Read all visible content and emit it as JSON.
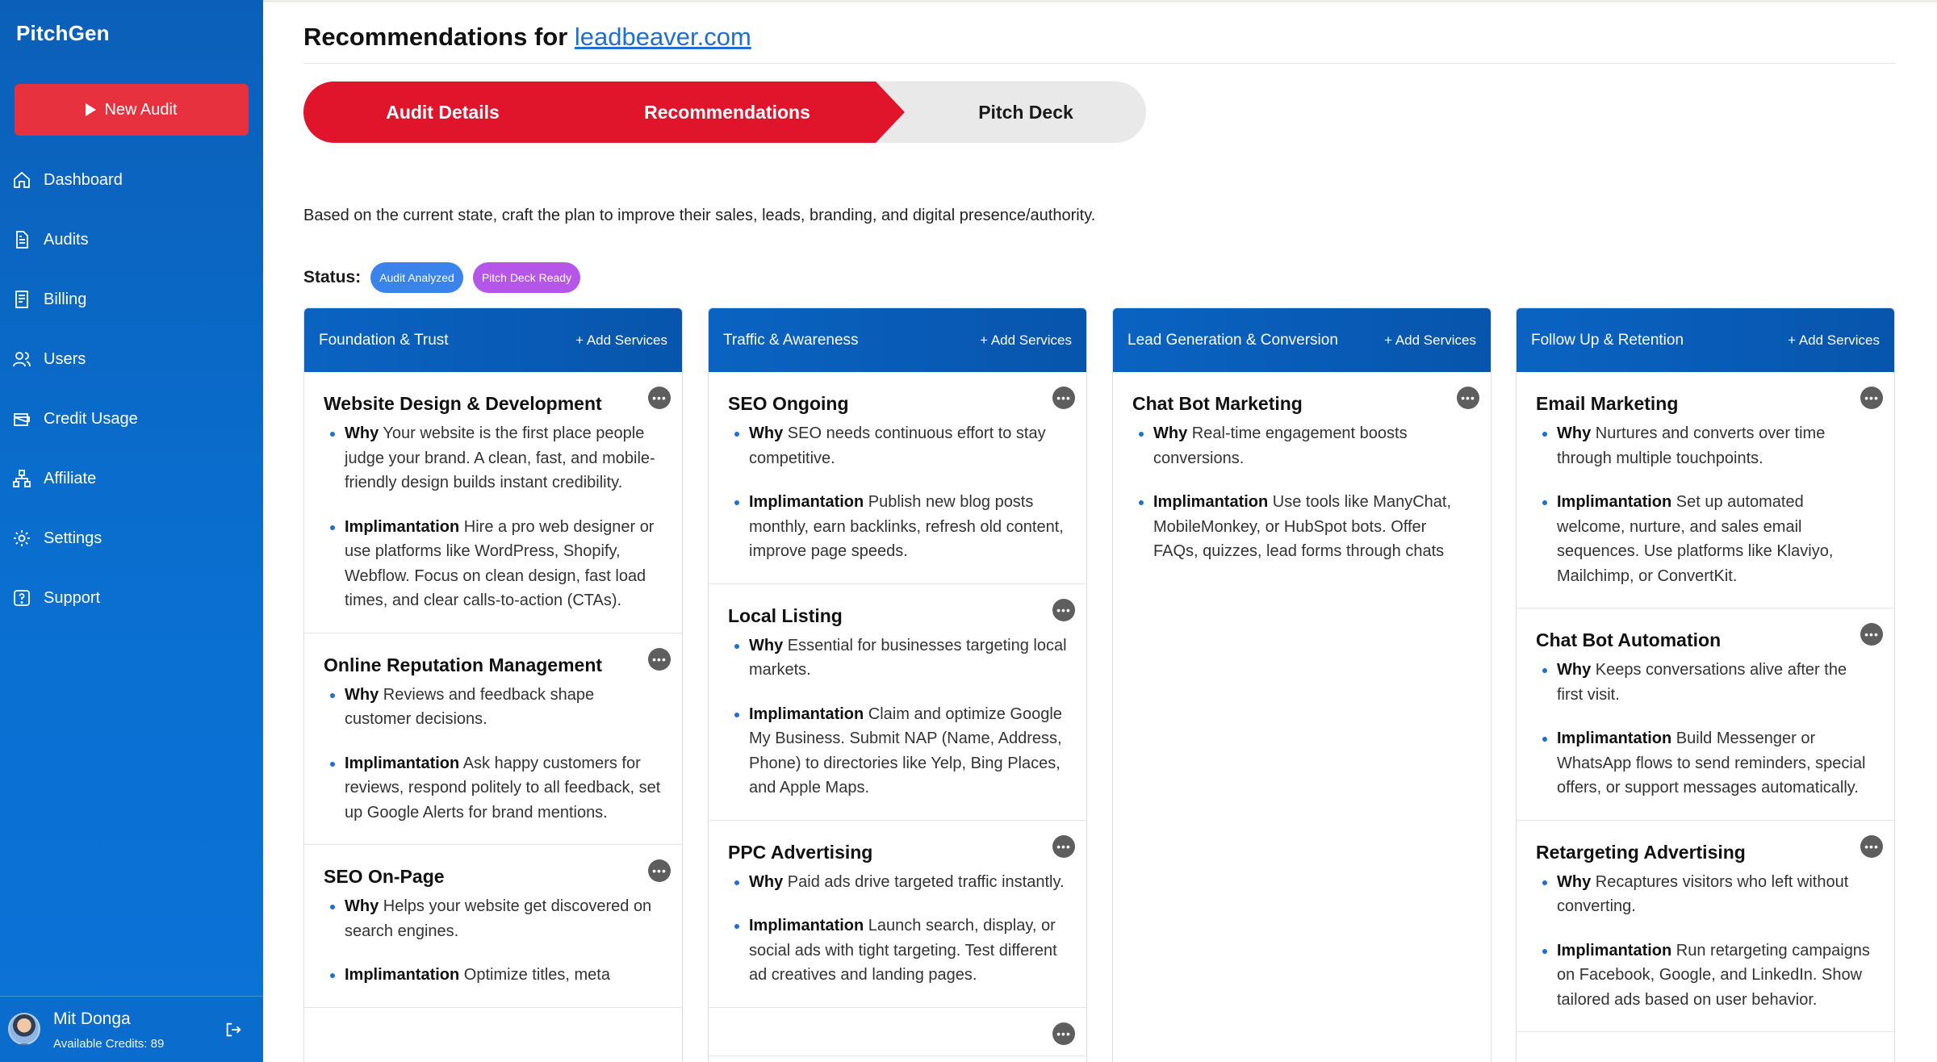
{
  "app": {
    "brand": "PitchGen",
    "new_audit_label": "New Audit"
  },
  "sidebar": {
    "items": [
      {
        "label": "Dashboard",
        "icon": "home-icon"
      },
      {
        "label": "Audits",
        "icon": "document-icon"
      },
      {
        "label": "Billing",
        "icon": "receipt-icon"
      },
      {
        "label": "Users",
        "icon": "users-icon"
      },
      {
        "label": "Credit Usage",
        "icon": "wallet-icon"
      },
      {
        "label": "Affiliate",
        "icon": "network-icon"
      },
      {
        "label": "Settings",
        "icon": "gear-icon"
      },
      {
        "label": "Support",
        "icon": "help-icon"
      }
    ],
    "user": {
      "name": "Mit Donga",
      "credits": "Available Credits: 89"
    }
  },
  "page": {
    "title_prefix": "Recommendations for",
    "domain": "leadbeaver.com",
    "steps": [
      "Audit Details",
      "Recommendations",
      "Pitch Deck"
    ],
    "intro": "Based on the current state, craft the plan to improve their sales, leads, branding, and digital presence/authority.",
    "status_label": "Status:",
    "badges": [
      "Audit Analyzed",
      "Pitch Deck Ready"
    ],
    "colors": {
      "primary_blue": "#0a63c2",
      "accent_red": "#e0142a",
      "badge_blue": "#3a83ea",
      "badge_purple": "#b656e8"
    }
  },
  "columns": [
    {
      "title": "Foundation & Trust",
      "add_label": "+ Add Services",
      "cards": [
        {
          "title": "Website Design & Development",
          "why_label": "Why",
          "why": "Your website is the first place people judge your brand. A clean, fast, and mobile-friendly design builds instant credibility.",
          "impl_label": "Implimantation",
          "impl": "Hire a pro web designer or use platforms like WordPress, Shopify, Webflow. Focus on clean design, fast load times, and clear calls-to-action (CTAs)."
        },
        {
          "title": "Online Reputation Management",
          "why_label": "Why",
          "why": "Reviews and feedback shape customer decisions.",
          "impl_label": "Implimantation",
          "impl": "Ask happy customers for reviews, respond politely to all feedback, set up Google Alerts for brand mentions."
        },
        {
          "title": "SEO On-Page",
          "why_label": "Why",
          "why": "Helps your website get discovered on search engines.",
          "impl_label": "Implimantation",
          "impl": "Optimize titles, meta"
        }
      ]
    },
    {
      "title": "Traffic & Awareness",
      "add_label": "+ Add Services",
      "cards": [
        {
          "title": "SEO Ongoing",
          "why_label": "Why",
          "why": "SEO needs continuous effort to stay competitive.",
          "impl_label": "Implimantation",
          "impl": "Publish new blog posts monthly, earn backlinks, refresh old content, improve page speeds."
        },
        {
          "title": "Local Listing",
          "why_label": "Why",
          "why": "Essential for businesses targeting local markets.",
          "impl_label": "Implimantation",
          "impl": "Claim and optimize Google My Business. Submit NAP (Name, Address, Phone) to directories like Yelp, Bing Places, and Apple Maps."
        },
        {
          "title": "PPC Advertising",
          "why_label": "Why",
          "why": "Paid ads drive targeted traffic instantly.",
          "impl_label": "Implimantation",
          "impl": "Launch search, display, or social ads with tight targeting. Test different ad creatives and landing pages."
        }
      ]
    },
    {
      "title": "Lead Generation & Conversion",
      "add_label": "+ Add Services",
      "cards": [
        {
          "title": "Chat Bot Marketing",
          "why_label": "Why",
          "why": "Real-time engagement boosts conversions.",
          "impl_label": "Implimantation",
          "impl": "Use tools like ManyChat, MobileMonkey, or HubSpot bots. Offer FAQs, quizzes, lead forms through chats"
        }
      ]
    },
    {
      "title": "Follow Up & Retention",
      "add_label": "+ Add Services",
      "cards": [
        {
          "title": "Email Marketing",
          "why_label": "Why",
          "why": "Nurtures and converts over time through multiple touchpoints.",
          "impl_label": "Implimantation",
          "impl": "Set up automated welcome, nurture, and sales email sequences. Use platforms like Klaviyo, Mailchimp, or ConvertKit."
        },
        {
          "title": "Chat Bot Automation",
          "why_label": "Why",
          "why": "Keeps conversations alive after the first visit.",
          "impl_label": "Implimantation",
          "impl": "Build Messenger or WhatsApp flows to send reminders, special offers, or support messages automatically."
        },
        {
          "title": "Retargeting Advertising",
          "why_label": "Why",
          "why": "Recaptures visitors who left without converting.",
          "impl_label": "Implimantation",
          "impl": "Run retargeting campaigns on Facebook, Google, and LinkedIn. Show tailored ads based on user behavior."
        }
      ]
    }
  ]
}
